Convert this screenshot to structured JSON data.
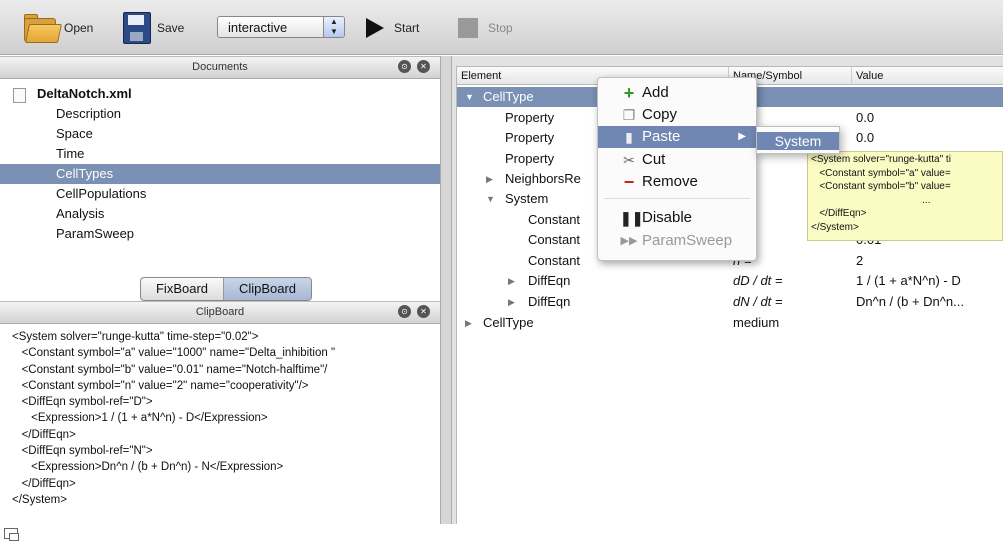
{
  "toolbar": {
    "open_label": "Open",
    "save_label": "Save",
    "mode_value": "interactive",
    "start_label": "Start",
    "stop_label": "Stop"
  },
  "documents": {
    "title": "Documents",
    "file": "DeltaNotch.xml",
    "items": [
      "Description",
      "Space",
      "Time",
      "CellTypes",
      "CellPopulations",
      "Analysis",
      "ParamSweep"
    ],
    "selected": "CellTypes"
  },
  "board_tabs": {
    "fix": "FixBoard",
    "clip": "ClipBoard"
  },
  "clipboard": {
    "title": "ClipBoard",
    "lines": [
      "<System solver=\"runge-kutta\" time-step=\"0.02\">",
      "   <Constant symbol=\"a\" value=\"1000\" name=\"Delta_inhibition \"",
      "   <Constant symbol=\"b\" value=\"0.01\" name=\"Notch-halftime\"/",
      "   <Constant symbol=\"n\" value=\"2\" name=\"cooperativity\"/>",
      "   <DiffEqn symbol-ref=\"D\">",
      "      <Expression>1 / (1 + a*N^n) - D</Expression>",
      "   </DiffEqn>",
      "   <DiffEqn symbol-ref=\"N\">",
      "      <Expression>Dn^n / (b + Dn^n) - N</Expression>",
      "   </DiffEqn>",
      "</System>"
    ]
  },
  "tree": {
    "headers": {
      "element": "Element",
      "name": "Name/Symbol",
      "value": "Value"
    },
    "rows": [
      {
        "element": "CellType",
        "name": "",
        "value": ""
      },
      {
        "element": "Property",
        "name": "",
        "value": "0.0"
      },
      {
        "element": "Property",
        "name": "",
        "value": "0.0"
      },
      {
        "element": "Property",
        "name": "",
        "value": ""
      },
      {
        "element": "NeighborsRe",
        "name": "",
        "value": ""
      },
      {
        "element": "System",
        "name": "",
        "value": ""
      },
      {
        "element": "Constant",
        "name": "",
        "value": ""
      },
      {
        "element": "Constant",
        "name": "",
        "value": "0.01"
      },
      {
        "element": "Constant",
        "name": "n =",
        "value": "2"
      },
      {
        "element": "DiffEqn",
        "name": "dD / dt =",
        "value": "1 / (1 + a*N^n) - D"
      },
      {
        "element": "DiffEqn",
        "name": "dN / dt =",
        "value": "Dn^n / (b + Dn^n..."
      },
      {
        "element": "CellType",
        "name": "medium",
        "value": ""
      }
    ]
  },
  "context_menu": {
    "items": [
      {
        "label": "Add",
        "icon": "plus-icon"
      },
      {
        "label": "Copy",
        "icon": "copy-icon"
      },
      {
        "label": "Paste",
        "icon": "paste-icon"
      },
      {
        "label": "Cut",
        "icon": "scissors-icon"
      },
      {
        "label": "Remove",
        "icon": "minus-icon"
      },
      {
        "label": "Disable",
        "icon": "pause-icon"
      },
      {
        "label": "ParamSweep",
        "icon": "fast-forward-icon"
      }
    ],
    "submenu_item": "System"
  },
  "tooltip": {
    "lines": [
      "<System solver=\"runge-kutta\" ti",
      "   <Constant symbol=\"a\" value=",
      "   <Constant symbol=\"b\" value=",
      "                                        ...",
      "   </DiffEqn>",
      "</System>"
    ]
  },
  "colors": {
    "selection": "#7a90b4",
    "menu_highlight": "#6f87b2",
    "tooltip_bg": "#fbfbc4"
  }
}
